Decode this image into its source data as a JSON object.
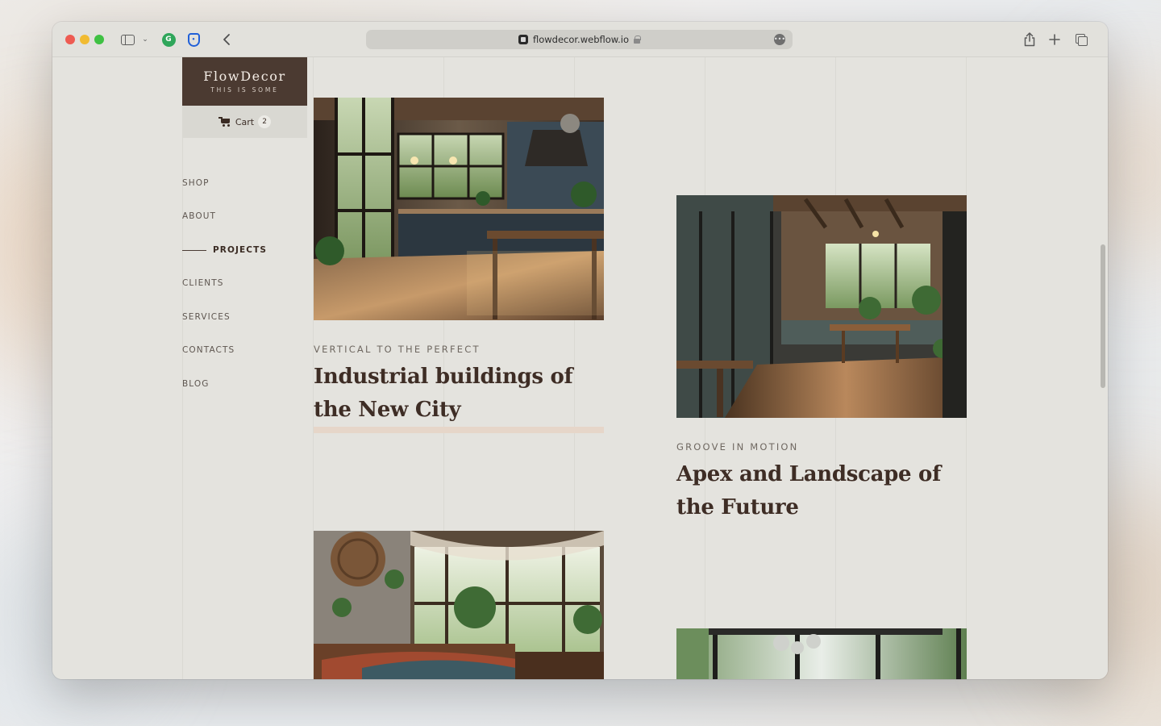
{
  "browser": {
    "url": "flowdecor.webflow.io"
  },
  "brand": {
    "name": "FlowDecor",
    "tagline": "THIS IS SOME"
  },
  "cart": {
    "label": "Cart",
    "count": "2"
  },
  "nav": {
    "items": [
      {
        "label": "SHOP",
        "active": false
      },
      {
        "label": "ABOUT",
        "active": false
      },
      {
        "label": "PROJECTS",
        "active": true
      },
      {
        "label": "CLIENTS",
        "active": false
      },
      {
        "label": "SERVICES",
        "active": false
      },
      {
        "label": "CONTACTS",
        "active": false
      },
      {
        "label": "BLOG",
        "active": false
      }
    ]
  },
  "projects": [
    {
      "eyebrow": "VERTICAL TO THE PERFECT",
      "title": "Industrial buildings of the New City"
    },
    {
      "eyebrow": "GROOVE IN MOTION",
      "title": "Apex and Landscape of the Future"
    }
  ],
  "colors": {
    "brand_bg": "#4b3a31",
    "page_bg": "#e4e3de",
    "title_text": "#3e2d25",
    "hover_bar": "#e6d6c9"
  }
}
